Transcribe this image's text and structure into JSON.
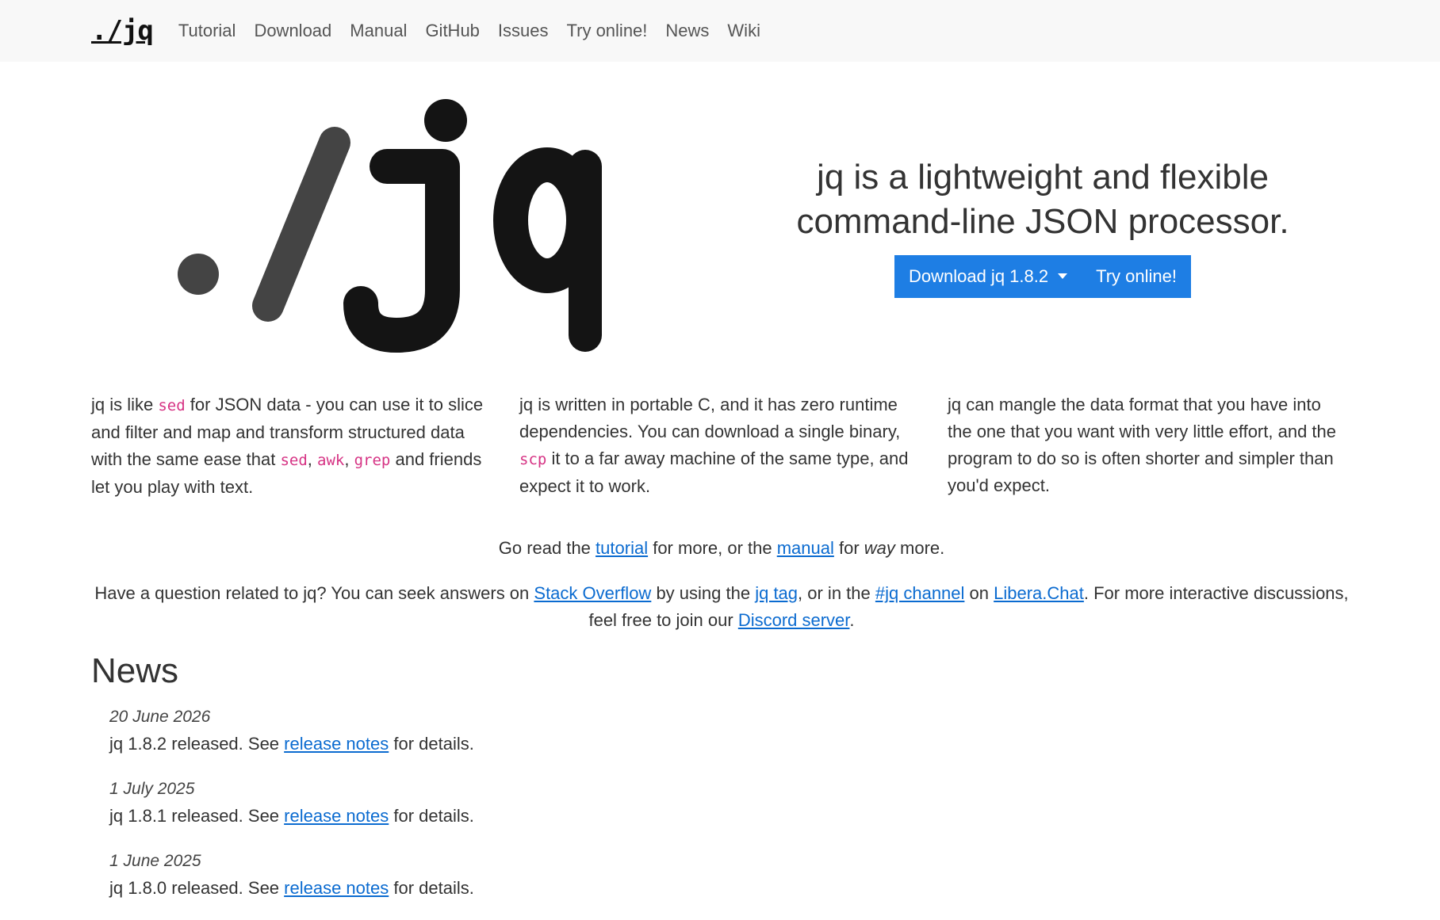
{
  "nav": {
    "brand": "./jq",
    "links": [
      "Tutorial",
      "Download",
      "Manual",
      "GitHub",
      "Issues",
      "Try online!",
      "News",
      "Wiki"
    ]
  },
  "hero": {
    "logo_text": "./jq",
    "tagline_line1": "jq is a lightweight and flexible",
    "tagline_line2": "command-line JSON processor.",
    "download_button": "Download jq 1.8.2",
    "try_button": "Try online!",
    "accent_color": "#1e7ee4"
  },
  "features": {
    "col1": {
      "t1": "jq is like ",
      "c1": "sed",
      "t2": " for JSON data - you can use it to slice and filter and map and transform structured data with the same ease that ",
      "c2": "sed",
      "t3": ", ",
      "c3": "awk",
      "t4": ", ",
      "c4": "grep",
      "t5": " and friends let you play with text."
    },
    "col2": {
      "t1": "jq is written in portable C, and it has zero runtime dependencies. You can download a single binary, ",
      "c1": "scp",
      "t2": " it to a far away machine of the same type, and expect it to work."
    },
    "col3": {
      "t1": "jq can mangle the data format that you have into the one that you want with very little effort, and the program to do so is often shorter and simpler than you'd expect."
    }
  },
  "read_more": {
    "t1": "Go read the ",
    "link1": "tutorial",
    "t2": " for more, or the ",
    "link2": "manual",
    "t3": " for ",
    "em": "way",
    "t4": " more."
  },
  "question": {
    "t1": "Have a question related to jq? You can seek answers on ",
    "link1": "Stack Overflow",
    "t2": " by using the ",
    "link2": "jq tag",
    "t3": ", or in the ",
    "link3": "#jq channel",
    "t4": " on ",
    "link4": "Libera.Chat",
    "t5": ". For more interactive discussions, feel free to join our ",
    "link5": "Discord server",
    "t6": "."
  },
  "news": {
    "title": "News",
    "items": [
      {
        "date": "20 June 2026",
        "text_before": "jq 1.8.2 released. See ",
        "link": "release notes",
        "text_after": " for details."
      },
      {
        "date": "1 July 2025",
        "text_before": "jq 1.8.1 released. See ",
        "link": "release notes",
        "text_after": " for details."
      },
      {
        "date": "1 June 2025",
        "text_before": "jq 1.8.0 released. See ",
        "link": "release notes",
        "text_after": " for details."
      }
    ]
  }
}
